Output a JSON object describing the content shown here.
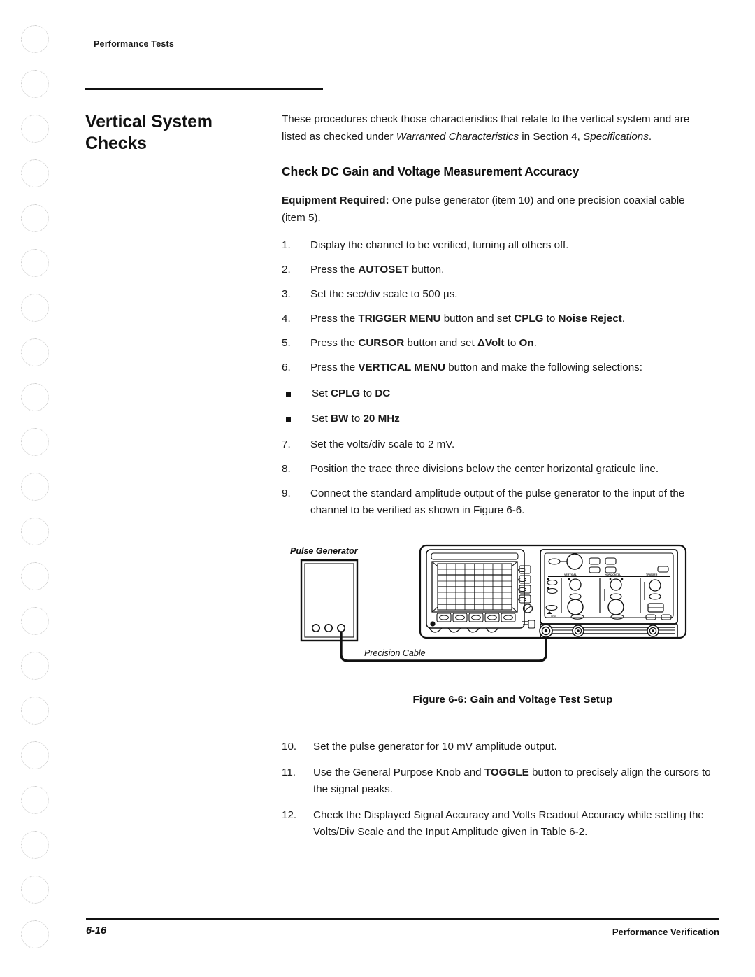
{
  "page": {
    "running_header": "Performance Tests",
    "section_title": "Vertical System Checks",
    "intro_html": "These procedures check those characteristics that relate to the vertical system and are listed as checked under <i>Warranted Characteristics</i> in Section 4, <i>Specifications</i>.",
    "subsection_title": "Check DC Gain and Voltage Measurement Accuracy",
    "equipment_html": "<b>Equipment Required:</b> One pulse generator (item 10) and one precision coaxial cable (item 5)."
  },
  "steps_upper": [
    {
      "num": "1.",
      "html": "Display the channel to be verified, turning all others off."
    },
    {
      "num": "2.",
      "html": "Press the <b>AUTOSET</b> button."
    },
    {
      "num": "3.",
      "html": "Set the sec/div scale to 500 &micro;s."
    },
    {
      "num": "4.",
      "html": "Press the <b>TRIGGER MENU</b> button and set <b>CPLG</b> to <b>Noise Reject</b>."
    },
    {
      "num": "5.",
      "html": "Press the <b>CURSOR</b> button and set <b>&Delta;Volt</b> to <b>On</b>."
    },
    {
      "num": "6.",
      "html": "Press the <b>VERTICAL MENU</b> button and make the following selections:"
    }
  ],
  "step6_bullets": [
    {
      "html": "Set <b>CPLG</b> to <b>DC</b>"
    },
    {
      "html": "Set <b>BW</b> to <b>20 MHz</b>"
    }
  ],
  "steps_upper_tail": [
    {
      "num": "7.",
      "html": "Set the volts/div scale to 2 mV."
    },
    {
      "num": "8.",
      "html": "Position the trace three divisions below the center horizontal graticule line."
    },
    {
      "num": "9.",
      "html": "Connect the standard amplitude output of the pulse generator to the input of the channel to be verified as shown in Figure 6-6."
    }
  ],
  "figure": {
    "pulse_generator_label": "Pulse Generator",
    "cable_label": "Precision Cable",
    "caption": "Figure 6-6:  Gain and Voltage Test Setup",
    "scope_panel_labels": [
      "VERTICAL",
      "HORIZONTAL",
      "TRIGGER"
    ]
  },
  "steps_lower": [
    {
      "num": "10.",
      "html": "Set the pulse generator for 10 mV amplitude output."
    },
    {
      "num": "11.",
      "html": "Use the General Purpose Knob and <b>TOGGLE</b> button to precisely align the cursors to the signal peaks."
    },
    {
      "num": "12.",
      "html": "Check the Displayed Signal Accuracy and Volts Readout Accuracy while setting the Volts/Div Scale and the Input Amplitude given in Table 6-2."
    }
  ],
  "footer": {
    "page_number": "6-16",
    "right_text": "Performance Verification"
  },
  "colors": {
    "ink": "#111111",
    "body_text": "#1a1a1a",
    "hole_outline": "#c9c9c9",
    "paper": "#ffffff"
  }
}
